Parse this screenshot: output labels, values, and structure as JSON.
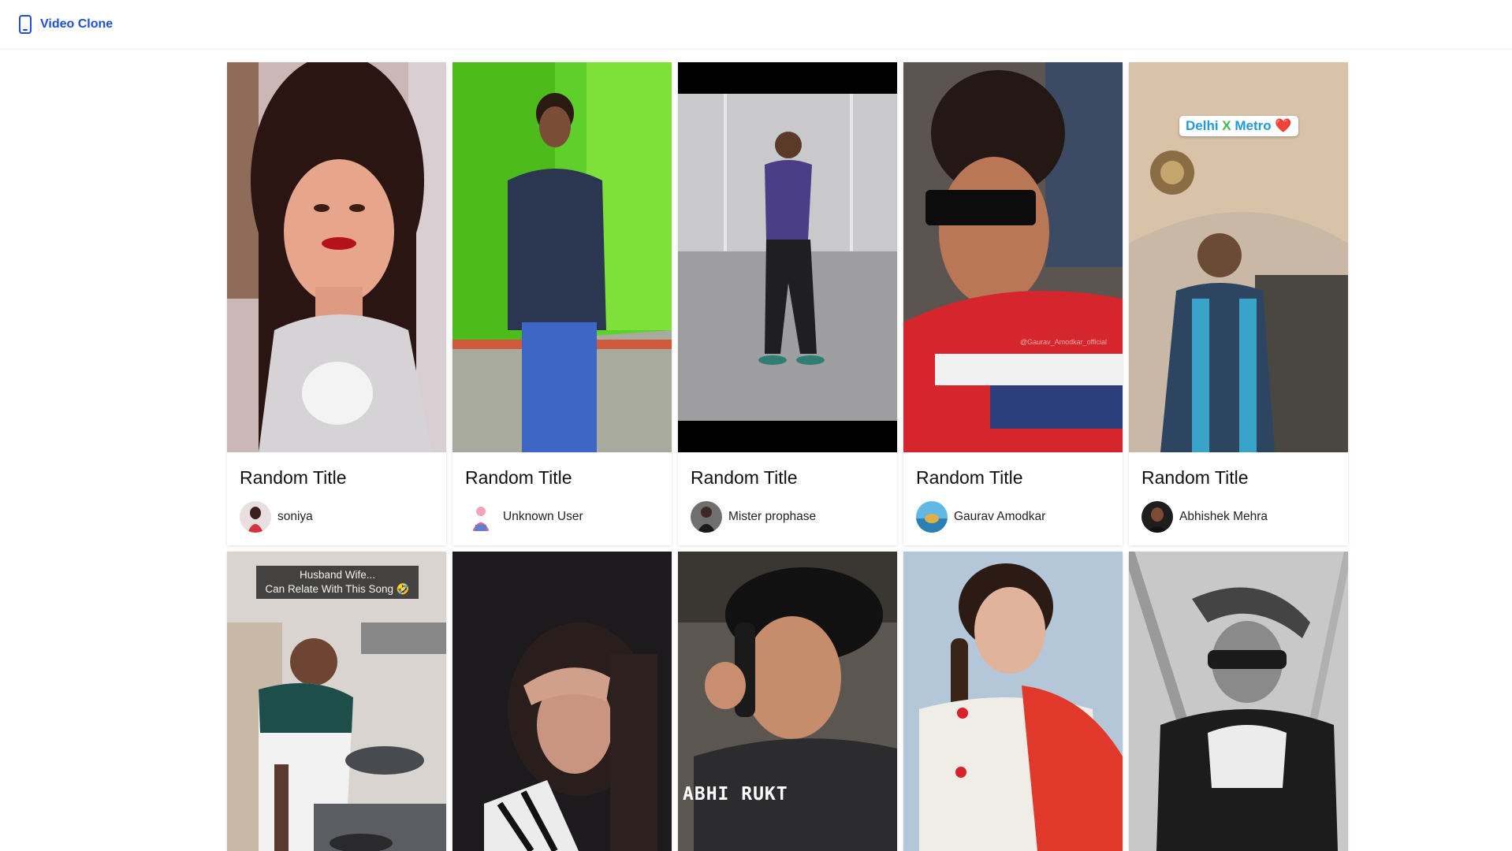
{
  "app": {
    "name": "Video Clone",
    "icon": "smartphone-icon",
    "accent": "#1d4ed8"
  },
  "videos": [
    {
      "title": "Random Title",
      "user": "soniya"
    },
    {
      "title": "Random Title",
      "user": "Unknown User"
    },
    {
      "title": "Random Title",
      "user": "Mister prophase"
    },
    {
      "title": "Random Title",
      "user": "Gaurav Amodkar"
    },
    {
      "title": "Random Title",
      "user": "Abhishek Mehra"
    }
  ],
  "overlays": {
    "metro_tag": {
      "part1": "Delhi",
      "part2": "X",
      "part3": "Metro",
      "emoji": "❤️"
    },
    "watermark": "@Gaurav_Amodkar_official",
    "song_caption": {
      "line1": "Husband Wife...",
      "line2": "Can Relate With This Song 🤣"
    },
    "graffiti": "ABHI RUKT"
  }
}
